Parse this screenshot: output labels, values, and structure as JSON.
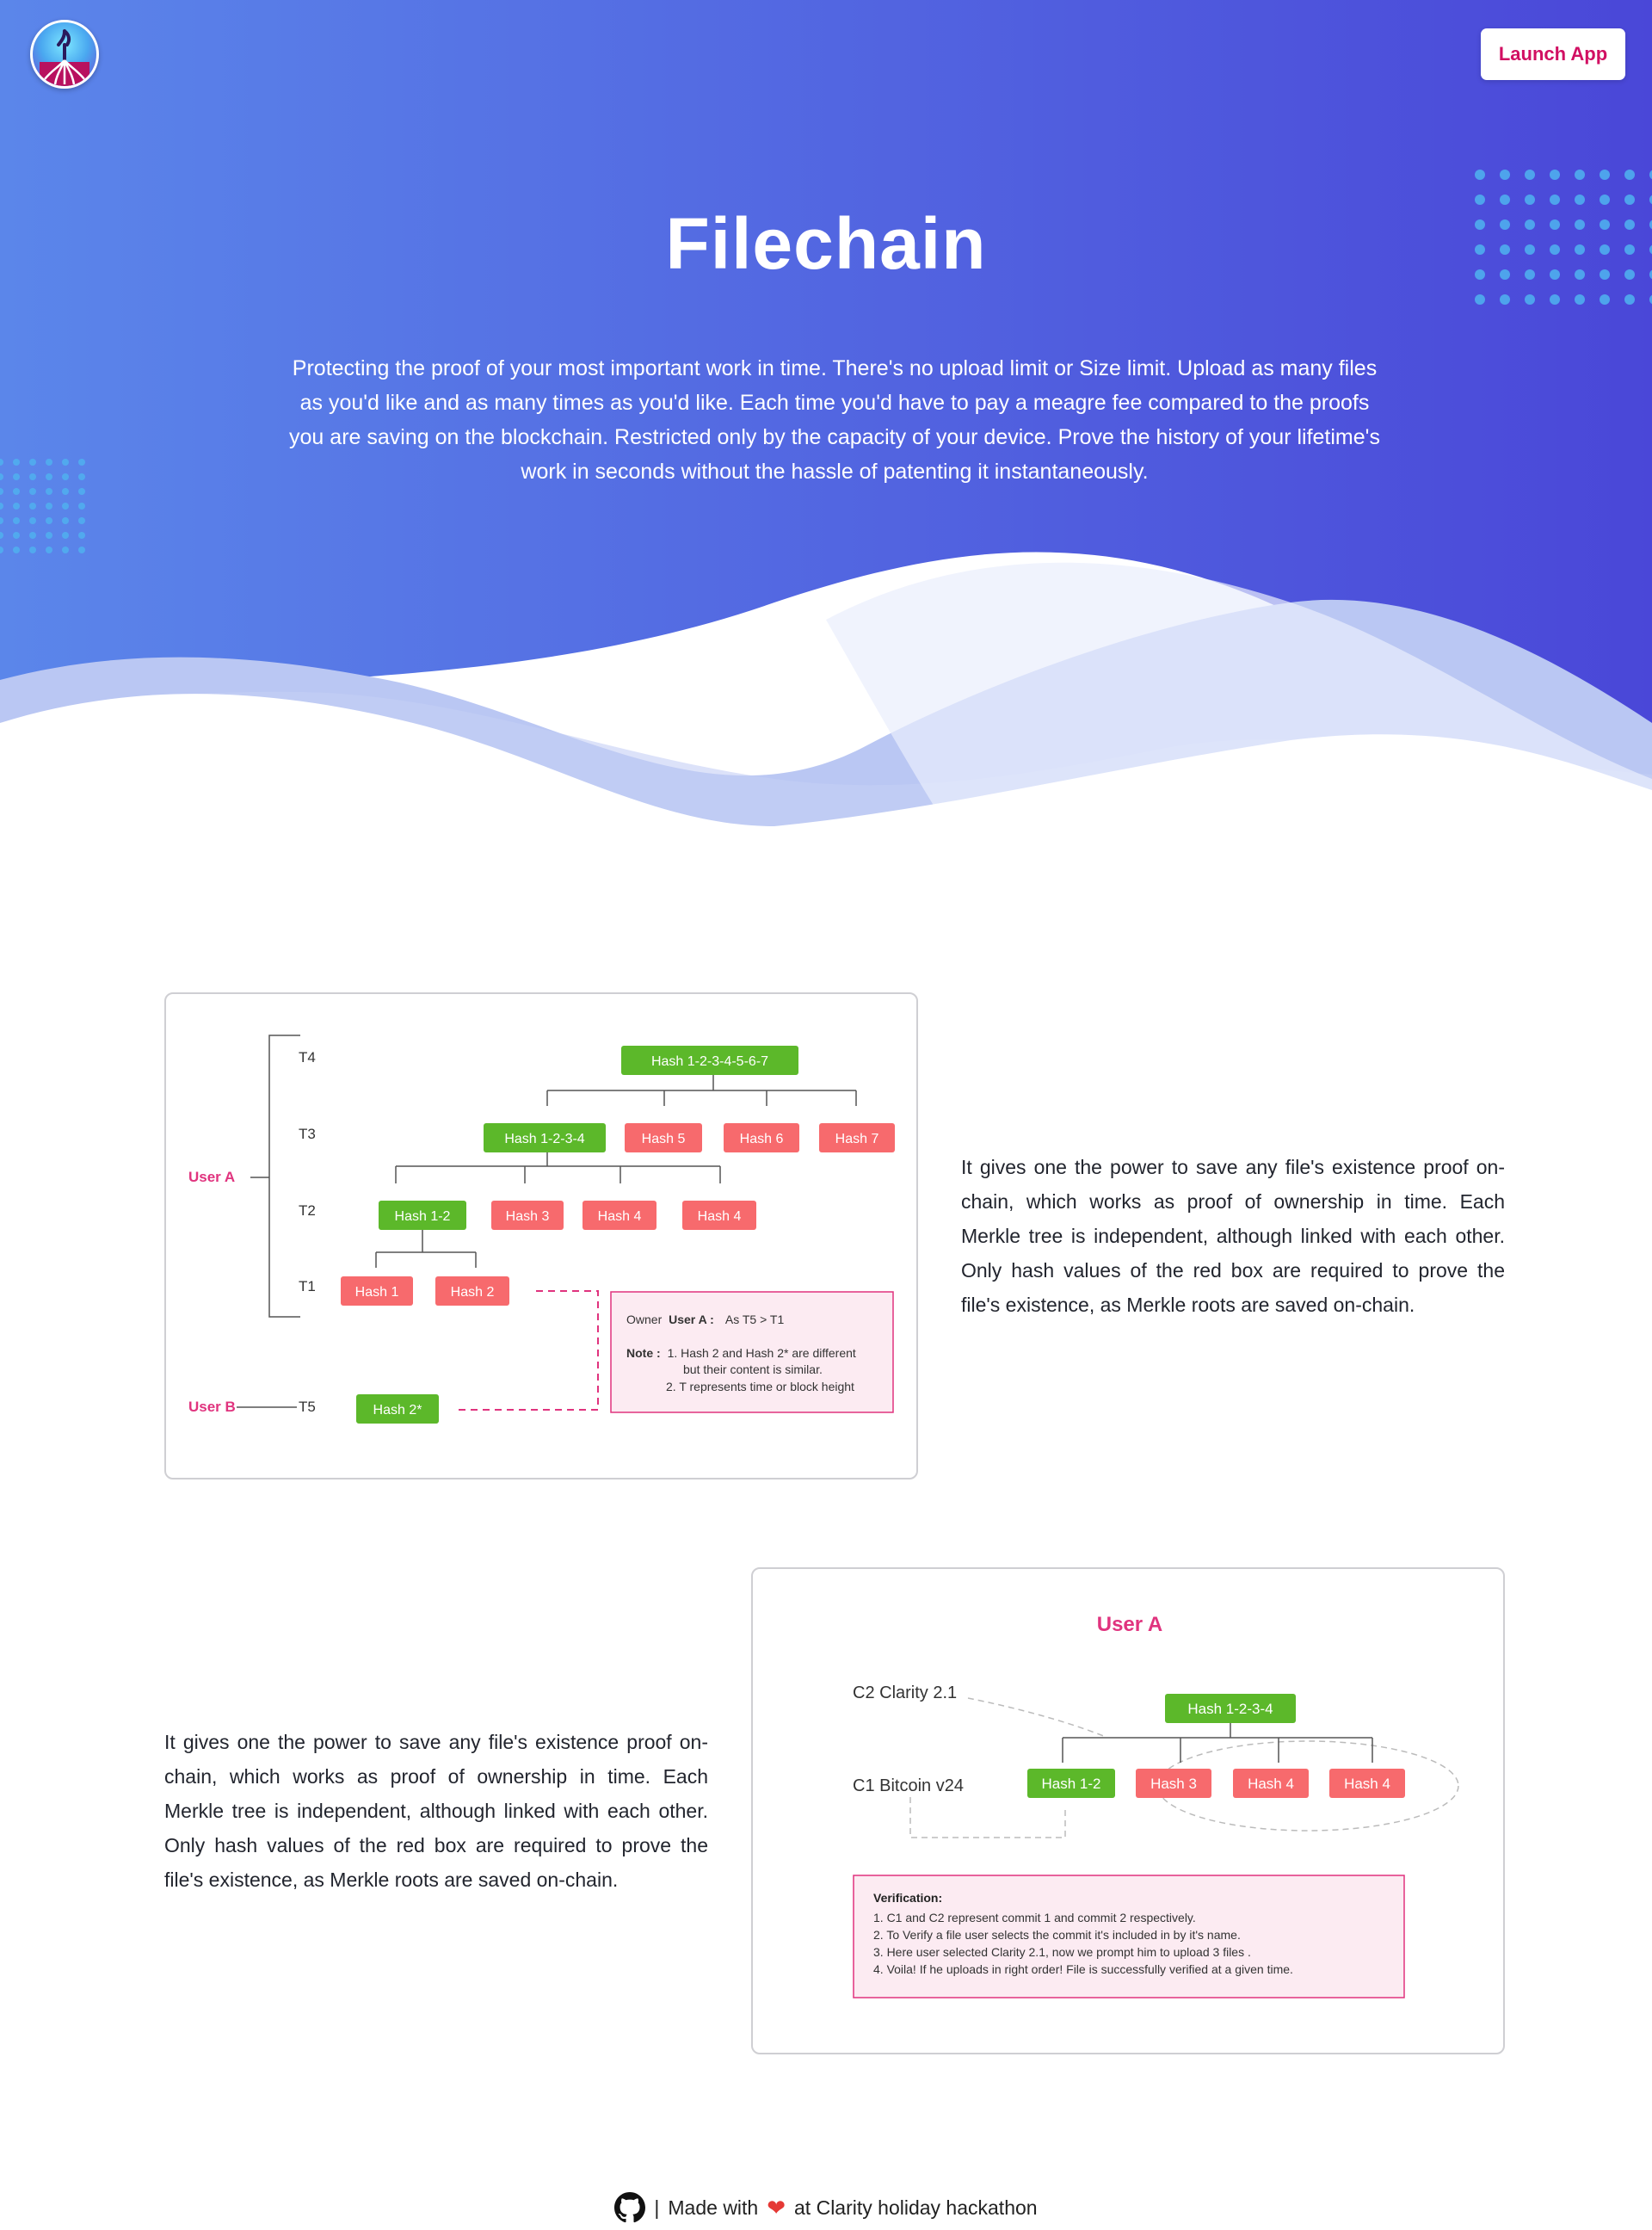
{
  "header": {
    "logo_icon": "filechain-tree-logo-icon",
    "launch_label": "Launch App"
  },
  "hero": {
    "title": "Filechain",
    "description": "Protecting the proof of your most important work in time. There's no upload limit or Size limit. Upload as many files as you'd like and as many times as you'd like. Each time you'd have to pay a meagre fee compared to the proofs you are saving on the blockchain. Restricted only by the capacity of your device. Prove the history of your lifetime's work in seconds without the hassle of patenting it instantaneously."
  },
  "colors": {
    "hero_start": "#5b86ea",
    "hero_end": "#4a47d8",
    "green": "#5cb82a",
    "red": "#f76a6d",
    "pink": "#e0337e",
    "accent": "#d10f62"
  },
  "diagram1": {
    "levels": [
      "T4",
      "T3",
      "T2",
      "T1"
    ],
    "t5": "T5",
    "user_a": "User A",
    "user_b": "User B",
    "nodes": {
      "root": "Hash 1-2-3-4-5-6-7",
      "h1234": "Hash 1-2-3-4",
      "h5": "Hash 5",
      "h6": "Hash 6",
      "h7": "Hash 7",
      "h12": "Hash 1-2",
      "h3": "Hash 3",
      "h4a": "Hash 4",
      "h4b": "Hash 4",
      "h1": "Hash 1",
      "h2": "Hash 2",
      "h2star": "Hash 2*"
    },
    "note": {
      "owner_prefix": "Owner",
      "owner_user": "User A :",
      "owner_value": "As T5 > T1",
      "note_label": "Note :",
      "line1": "1. Hash 2 and Hash 2* are different",
      "line1b": "but their content is similar.",
      "line2": "2. T represents time or block height"
    }
  },
  "section1": {
    "text": "It gives one the power to save any file's existence proof on-chain, which works as proof of ownership in time. Each Merkle tree is independent, although linked with each other. Only hash values of the red box are required to prove the file's existence, as Merkle roots are saved on-chain."
  },
  "diagram2": {
    "title": "User A",
    "c2": "C2 Clarity 2.1",
    "c1": "C1 Bitcoin v24",
    "nodes": {
      "h1234": "Hash 1-2-3-4",
      "h12": "Hash 1-2",
      "h3": "Hash 3",
      "h4a": "Hash 4",
      "h4b": "Hash 4"
    },
    "verification": {
      "title": "Verification:",
      "lines": [
        "1. C1 and C2 represent commit 1 and commit 2 respectively.",
        "2. To Verify a file user selects the commit it's included in by it's name.",
        "3. Here user selected Clarity 2.1, now we prompt him to upload 3 files .",
        "4. Voila! If he uploads in right order! File is successfully verified at a given time."
      ]
    }
  },
  "section2": {
    "text": "It gives one the power to save any file's existence proof on-chain, which works as proof of ownership in time. Each Merkle tree is independent, although linked with each other. Only hash values of the red box are required to prove the file's existence, as Merkle roots are saved on-chain."
  },
  "footer": {
    "github_icon": "github-icon",
    "separator": "|",
    "made_with": "Made with",
    "heart_icon": "heart-icon",
    "heart": "❤",
    "hackathon": "at Clarity holiday hackathon"
  }
}
